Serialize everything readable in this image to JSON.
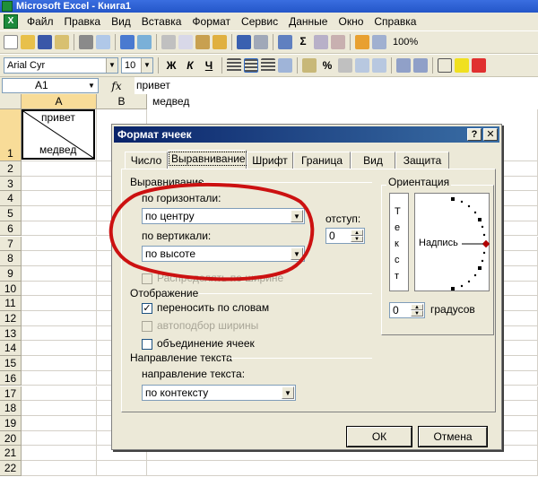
{
  "window": {
    "title": "Microsoft Excel - Книга1"
  },
  "menu": [
    "Файл",
    "Правка",
    "Вид",
    "Вставка",
    "Формат",
    "Сервис",
    "Данные",
    "Окно",
    "Справка"
  ],
  "toolbar": {
    "zoom": "100%"
  },
  "format_toolbar": {
    "font": "Arial Cyr",
    "size": "10",
    "bold": "Ж",
    "italic": "К",
    "underline": "Ч"
  },
  "formula_bar": {
    "name_box": "A1",
    "fx": "fx",
    "line1": "привет",
    "line2": "медвед"
  },
  "sheet": {
    "columns": [
      "A",
      "B"
    ],
    "rows": [
      "1",
      "2",
      "3",
      "4",
      "5",
      "6",
      "7",
      "8",
      "9",
      "10",
      "11",
      "12",
      "13",
      "14",
      "15",
      "16",
      "17",
      "18",
      "19",
      "20",
      "21",
      "22"
    ],
    "cell_a1": {
      "top": "привет",
      "bottom": "медвед"
    }
  },
  "dialog": {
    "title": "Формат ячеек",
    "help": "?",
    "close": "✕",
    "tabs": [
      "Число",
      "Выравнивание",
      "Шрифт",
      "Граница",
      "Вид",
      "Защита"
    ],
    "alignment_group": "Выравнивание",
    "horizontal_label": "по горизонтали:",
    "horizontal_value": "по центру",
    "vertical_label": "по вертикали:",
    "vertical_value": "по высоте",
    "indent_label": "отступ:",
    "indent_value": "0",
    "distribute_label": "Распределять по ширине",
    "display_group": "Отображение",
    "wrap_label": "переносить по словам",
    "autofit_label": "автоподбор ширины",
    "merge_label": "объединение ячеек",
    "direction_group": "Направление текста",
    "direction_label": "направление текста:",
    "direction_value": "по контексту",
    "orientation_group": "Ориентация",
    "orientation_vertical": [
      "Т",
      "е",
      "к",
      "с",
      "т"
    ],
    "orientation_label": "Надпись",
    "degrees_value": "0",
    "degrees_label": "градусов",
    "ok": "ОК",
    "cancel": "Отмена"
  },
  "colors": {
    "annotation": "#cc1111",
    "title_bar": "#2456c8",
    "dialog_title": "#0a246a"
  }
}
